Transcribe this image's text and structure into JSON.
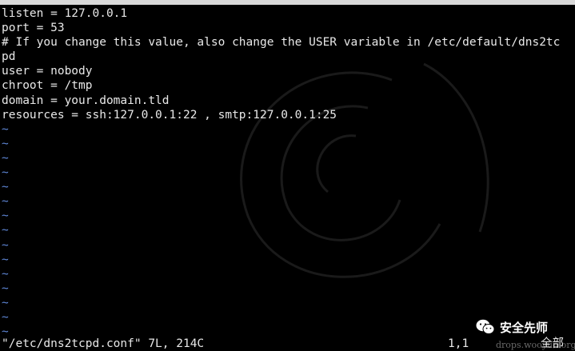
{
  "colors": {
    "background": "#000000",
    "text": "#e8e8e8",
    "tilde": "#5f87d7",
    "window_bar": "#d9d9d9"
  },
  "editor": {
    "lines": [
      "listen = 127.0.0.1",
      "port = 53",
      "# If you change this value, also change the USER variable in /etc/default/dns2tc",
      "pd",
      "user = nobody",
      "chroot = /tmp",
      "domain = your.domain.tld",
      "resources = ssh:127.0.0.1:22 , smtp:127.0.0.1:25"
    ],
    "empty_line_marker": "~"
  },
  "status": {
    "file_info": "\"/etc/dns2tcpd.conf\" 7L, 214C",
    "cursor": "1,1",
    "scroll": "全部"
  },
  "watermark": {
    "icon": "wechat-icon",
    "text": "安全先师",
    "url": "drops.wooyun.org"
  }
}
